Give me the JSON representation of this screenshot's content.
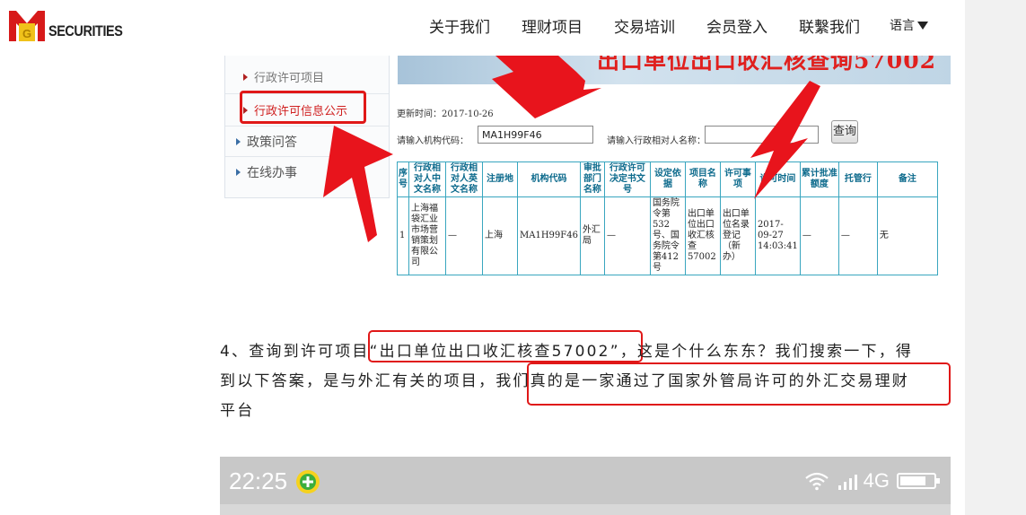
{
  "brand": {
    "logo_text": "SECURITIES",
    "accent": "#e01818"
  },
  "nav": {
    "items": [
      "关于我们",
      "理财项目",
      "交易培训",
      "会员登入",
      "联繫我们"
    ],
    "language_label": "语言"
  },
  "screenshot": {
    "sidebar": {
      "items": [
        "行政许可项目",
        "行政许可信息公示"
      ],
      "main_items": [
        "政策问答",
        "在线办事"
      ]
    },
    "banner_title": "出口单位出口收汇核查询57002",
    "update_time": "更新时间：2017-10-26",
    "search": {
      "code_label": "请输入机构代码：",
      "code_value": "MA1H99F46",
      "name_label": "请输入行政相对人名称：",
      "name_value": "",
      "button_label": "查询"
    },
    "table": {
      "headers": [
        "序号",
        "行政相对人中文名称",
        "行政相对人英文名称",
        "注册地",
        "机构代码",
        "审批部门名称",
        "行政许可决定书文号",
        "设定依据",
        "项目名称",
        "许可事项",
        "许可时间",
        "累计批准额度",
        "托管行",
        "备注"
      ],
      "rows": [
        [
          "1",
          "上海福袋汇业市场营销策划有限公司",
          "—",
          "上海",
          "MA1H99F46",
          "外汇局",
          "—",
          "国务院令第532号、国务院令第412号",
          "出口单位出口收汇核查57002",
          "出口单位名录登记（新办）",
          "2017-09-27 14:03:41",
          "—",
          "—",
          "无"
        ]
      ]
    }
  },
  "paragraph": {
    "line1": "4、查询到许可项目“出口单位出口收汇核查57002”，这是个什么东东？我们搜索一下，得",
    "line2": "到以下答案，是与外汇有关的项目，我们真的是一家通过了国家外管局许可的外汇交易理财",
    "line3": "平台"
  },
  "phone": {
    "time": "22:25",
    "network": "4G"
  }
}
